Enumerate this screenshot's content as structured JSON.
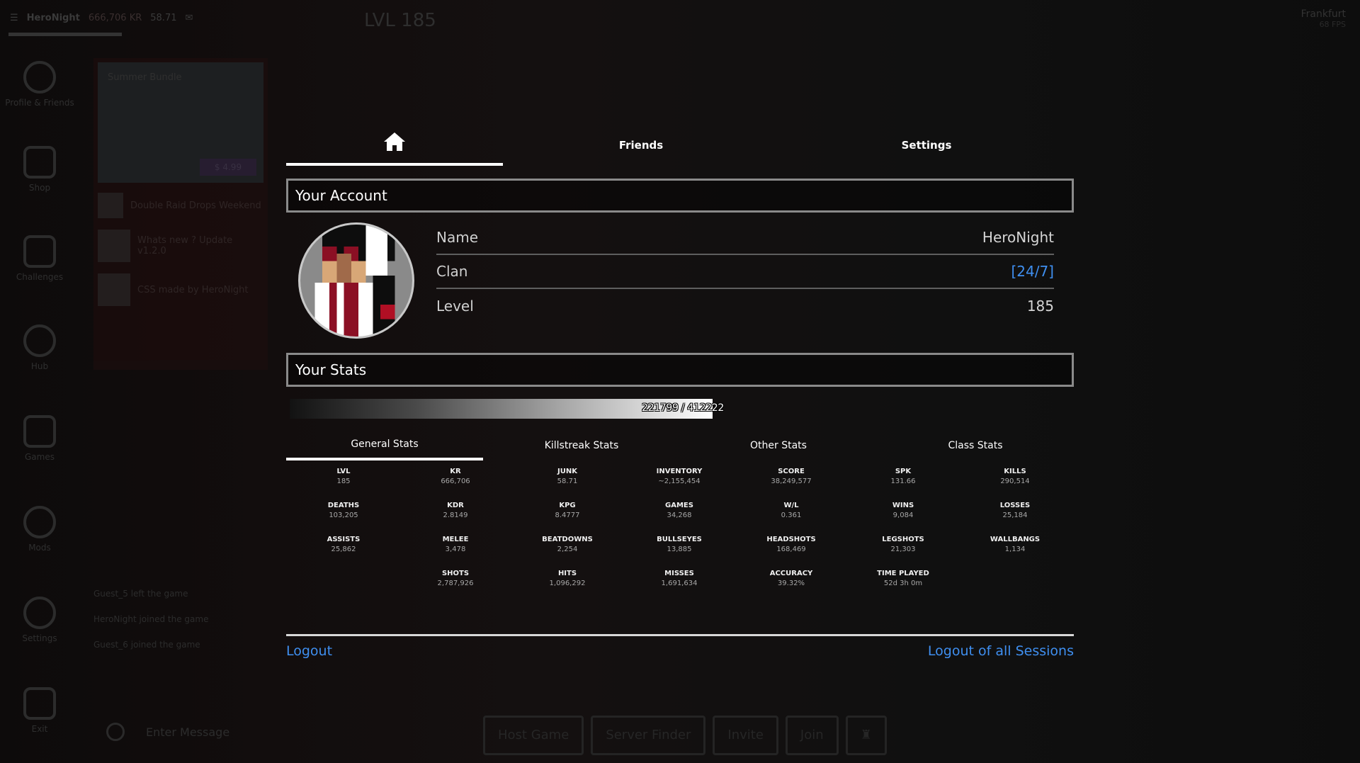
{
  "background": {
    "username": "HeroNight",
    "kr": "666,706 KR",
    "junk": "58.71",
    "level_label": "LVL 185",
    "region": "Frankfurt",
    "region_sub": "68 FPS",
    "rail": [
      "Profile & Friends",
      "Shop",
      "Challenges",
      "Hub",
      "Games",
      "Mods",
      "Settings",
      "Exit"
    ],
    "news": {
      "featured_title": "Summer Bundle",
      "featured_price": "$ 4.99",
      "items": [
        "Double Raid Drops Weekend",
        "Whats new ? Update v1.2.0",
        "CSS made by HeroNight"
      ]
    },
    "chat": [
      "Guest_5 left the game",
      "HeroNight joined the game",
      "Guest_6 joined the game"
    ],
    "chat_placeholder": "Enter Message",
    "bottom_buttons": [
      "Host Game",
      "Server Finder",
      "Invite",
      "Join"
    ]
  },
  "tabs": {
    "home_icon": "home-icon",
    "friends": "Friends",
    "settings": "Settings"
  },
  "account": {
    "heading": "Your Account",
    "rows": [
      {
        "label": "Name",
        "value": "HeroNight"
      },
      {
        "label": "Clan",
        "value": "[24/7]"
      },
      {
        "label": "Level",
        "value": "185"
      }
    ]
  },
  "stats": {
    "heading": "Your Stats",
    "xp_text": "221799 / 412222",
    "xp_progress": 0.538,
    "tabs": [
      "General Stats",
      "Killstreak Stats",
      "Other Stats",
      "Class Stats"
    ],
    "active_tab": 0,
    "items": [
      {
        "key": "LVL",
        "value": "185"
      },
      {
        "key": "KR",
        "value": "666,706"
      },
      {
        "key": "JUNK",
        "value": "58.71"
      },
      {
        "key": "INVENTORY",
        "value": "~2,155,454"
      },
      {
        "key": "SCORE",
        "value": "38,249,577"
      },
      {
        "key": "SPK",
        "value": "131.66"
      },
      {
        "key": "KILLS",
        "value": "290,514"
      },
      {
        "key": "DEATHS",
        "value": "103,205"
      },
      {
        "key": "KDR",
        "value": "2.8149"
      },
      {
        "key": "KPG",
        "value": "8.4777"
      },
      {
        "key": "GAMES",
        "value": "34,268"
      },
      {
        "key": "W/L",
        "value": "0.361"
      },
      {
        "key": "WINS",
        "value": "9,084"
      },
      {
        "key": "LOSSES",
        "value": "25,184"
      },
      {
        "key": "ASSISTS",
        "value": "25,862"
      },
      {
        "key": "MELEE",
        "value": "3,478"
      },
      {
        "key": "BEATDOWNS",
        "value": "2,254"
      },
      {
        "key": "BULLSEYES",
        "value": "13,885"
      },
      {
        "key": "HEADSHOTS",
        "value": "168,469"
      },
      {
        "key": "LEGSHOTS",
        "value": "21,303"
      },
      {
        "key": "WALLBANGS",
        "value": "1,134"
      },
      {
        "key": "SHOTS",
        "value": "2,787,926"
      },
      {
        "key": "HITS",
        "value": "1,096,292"
      },
      {
        "key": "MISSES",
        "value": "1,691,634"
      },
      {
        "key": "ACCURACY",
        "value": "39.32%"
      },
      {
        "key": "TIME PLAYED",
        "value": "52d 3h 0m"
      }
    ]
  },
  "links": {
    "logout": "Logout",
    "logout_all": "Logout of all Sessions"
  },
  "colors": {
    "accent_link": "#3f8ff0",
    "panel_border": "#8a8a8a"
  }
}
